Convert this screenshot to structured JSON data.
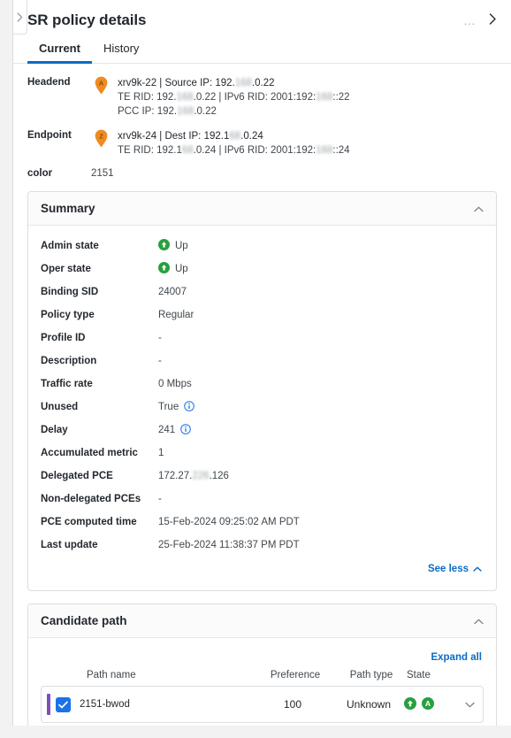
{
  "header": {
    "title": "SR policy details",
    "kebab_label": "…",
    "drawer_handle_icon": "chevron-right-icon",
    "close_icon": "chevron-right-icon"
  },
  "tabs": [
    {
      "label": "Current",
      "active": true
    },
    {
      "label": "History",
      "active": false
    }
  ],
  "endpoints": [
    {
      "label": "Headend",
      "pin": "A",
      "lines": [
        {
          "pre": "xrv9k-22 | Source IP: 192.",
          "blur": "168",
          "post": ".0.22"
        },
        {
          "pre": "TE RID: 192.",
          "blur": "168",
          "post": ".0.22 | IPv6 RID: 2001:192:",
          "blur2": "168",
          "post2": "::22"
        },
        {
          "pre": "PCC IP: 192.",
          "blur": "168",
          "post": ".0.22"
        }
      ]
    },
    {
      "label": "Endpoint",
      "pin": "Z",
      "lines": [
        {
          "pre": "xrv9k-24 | Dest IP: 192.1",
          "blur": "68",
          "post": ".0.24"
        },
        {
          "pre": "TE RID: 192.1",
          "blur": "68",
          "post": ".0.24 | IPv6 RID: 2001:192:",
          "blur2": "168",
          "post2": "::24"
        }
      ]
    }
  ],
  "color": {
    "label": "color",
    "value": "2151"
  },
  "summary": {
    "title": "Summary",
    "collapse_icon": "chevron-up-icon",
    "rows": [
      {
        "key": "Admin state",
        "value": "Up",
        "icon": "status-up-icon"
      },
      {
        "key": "Oper state",
        "value": "Up",
        "icon": "status-up-icon"
      },
      {
        "key": "Binding SID",
        "value": "24007"
      },
      {
        "key": "Policy type",
        "value": "Regular"
      },
      {
        "key": "Profile ID",
        "value": "-"
      },
      {
        "key": "Description",
        "value": "-"
      },
      {
        "key": "Traffic rate",
        "value": "0 Mbps"
      },
      {
        "key": "Unused",
        "value": "True",
        "info": true
      },
      {
        "key": "Delay",
        "value": "241",
        "info": true
      },
      {
        "key": "Accumulated metric",
        "value": "1"
      },
      {
        "key": "Delegated PCE",
        "value": "172.27.",
        "blur": "226",
        "value_post": ".126"
      },
      {
        "key": "Non-delegated PCEs",
        "value": "-"
      },
      {
        "key": "PCE computed time",
        "value": "15-Feb-2024 09:25:02 AM PDT"
      },
      {
        "key": "Last update",
        "value": "25-Feb-2024 11:38:37 PM PDT"
      }
    ],
    "see_less_label": "See less"
  },
  "candidate_path": {
    "title": "Candidate path",
    "collapse_icon": "chevron-up-icon",
    "expand_all_label": "Expand all",
    "columns": {
      "name": "Path name",
      "preference": "Preference",
      "type": "Path type",
      "state": "State"
    },
    "rows": [
      {
        "name": "2151-bwod",
        "preference": "100",
        "type": "Unknown",
        "checked": true,
        "state_icons": [
          "status-up-icon",
          "status-admin-a-icon"
        ],
        "expand_icon": "chevron-down-icon"
      }
    ]
  },
  "colors": {
    "accent_blue": "#0d6bc4",
    "link_blue": "#1a73e8",
    "status_green": "#27a03f",
    "pin_orange": "#ef8b22",
    "row_accent_purple": "#7d4fbd",
    "text_primary": "#23282e",
    "text_secondary": "#40474d"
  }
}
